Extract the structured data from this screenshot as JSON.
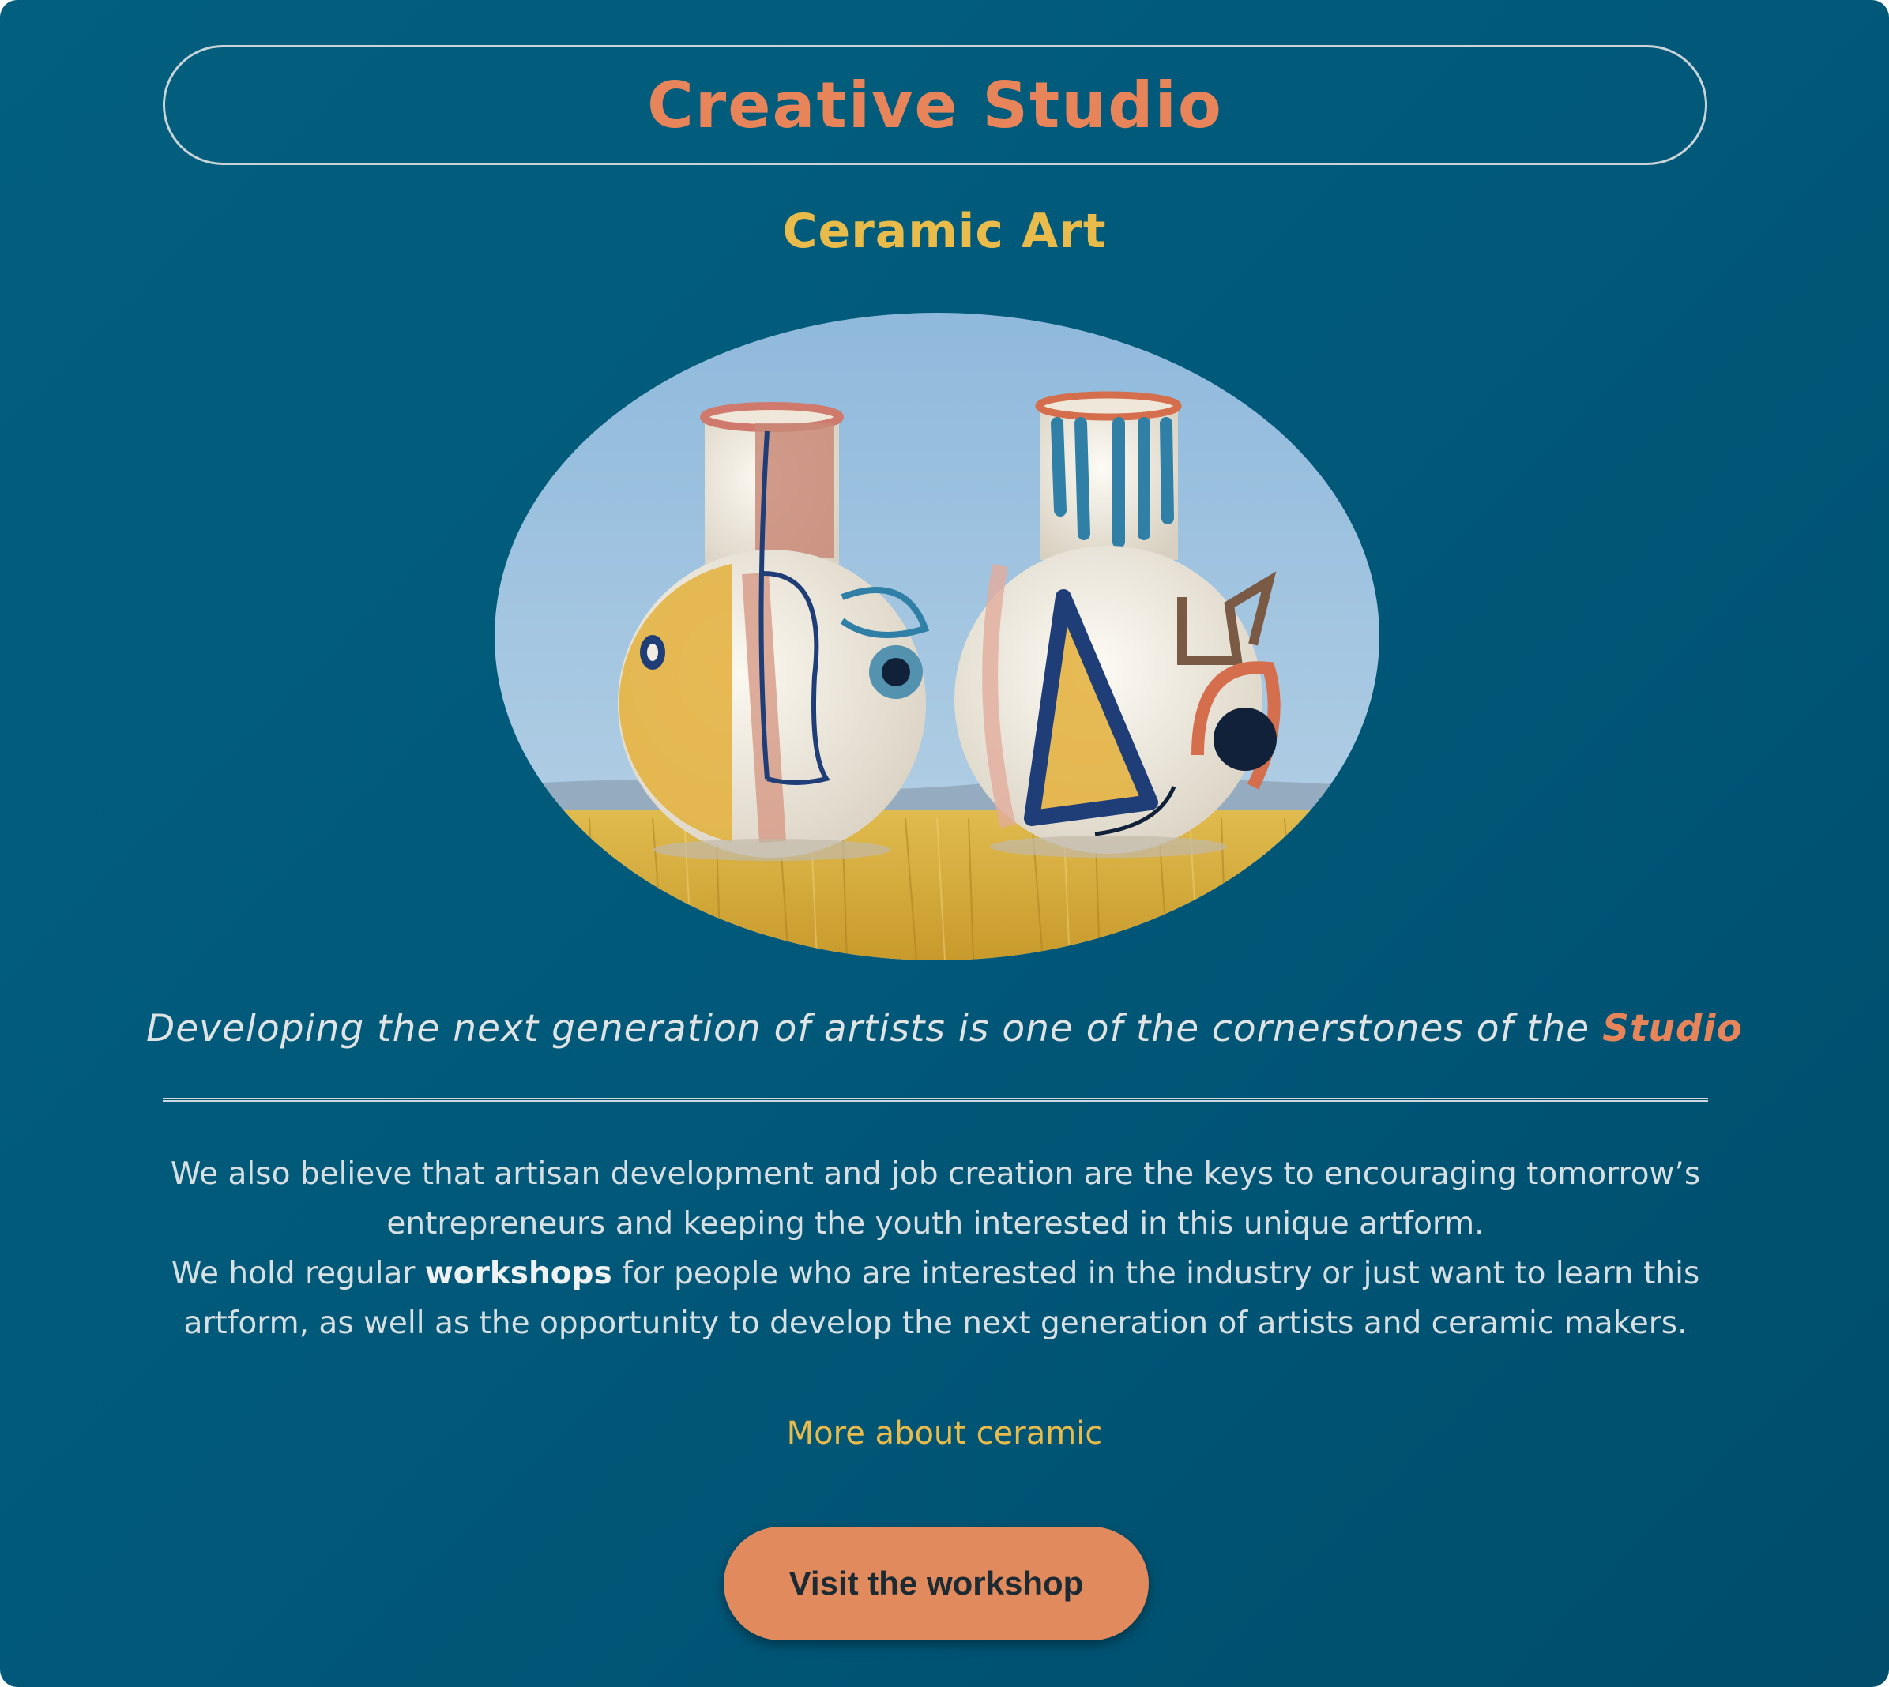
{
  "header": {
    "title": "Creative Studio"
  },
  "section": {
    "subtitle": "Ceramic Art"
  },
  "hero_image": {
    "subject": "two painted ceramic vases on yellow fabric under blue sky",
    "colors": {
      "sky": "#9cc2df",
      "fabric": "#d6ad3c",
      "glaze": "#f1ece1",
      "ochre": "#e3b343",
      "navy": "#1f3e78",
      "terracotta": "#d46e4c",
      "rose": "#c98978",
      "teal": "#2f7fa6"
    }
  },
  "tagline": {
    "text": "Developing the next generation of artists is one of the cornerstones of the ",
    "accent": "Studio"
  },
  "body": {
    "p1": "We also believe that artisan development and job creation are the keys to encouraging tomorrow’s entrepreneurs and keeping the youth interested in this unique artform.",
    "p2_before": "We hold regular ",
    "p2_bold": "workshops",
    "p2_after": " for people who are interested in the industry or just want to learn this artform, as well as the opportunity to develop the next generation of artists and ceramic makers."
  },
  "links": {
    "more": "More about ceramic"
  },
  "cta": {
    "label": "Visit the workshop"
  },
  "theme": {
    "background": "#025f7d",
    "title_color": "#e8845a",
    "subtitle_color": "#e9bb4a",
    "button_color": "#e08a5d"
  }
}
